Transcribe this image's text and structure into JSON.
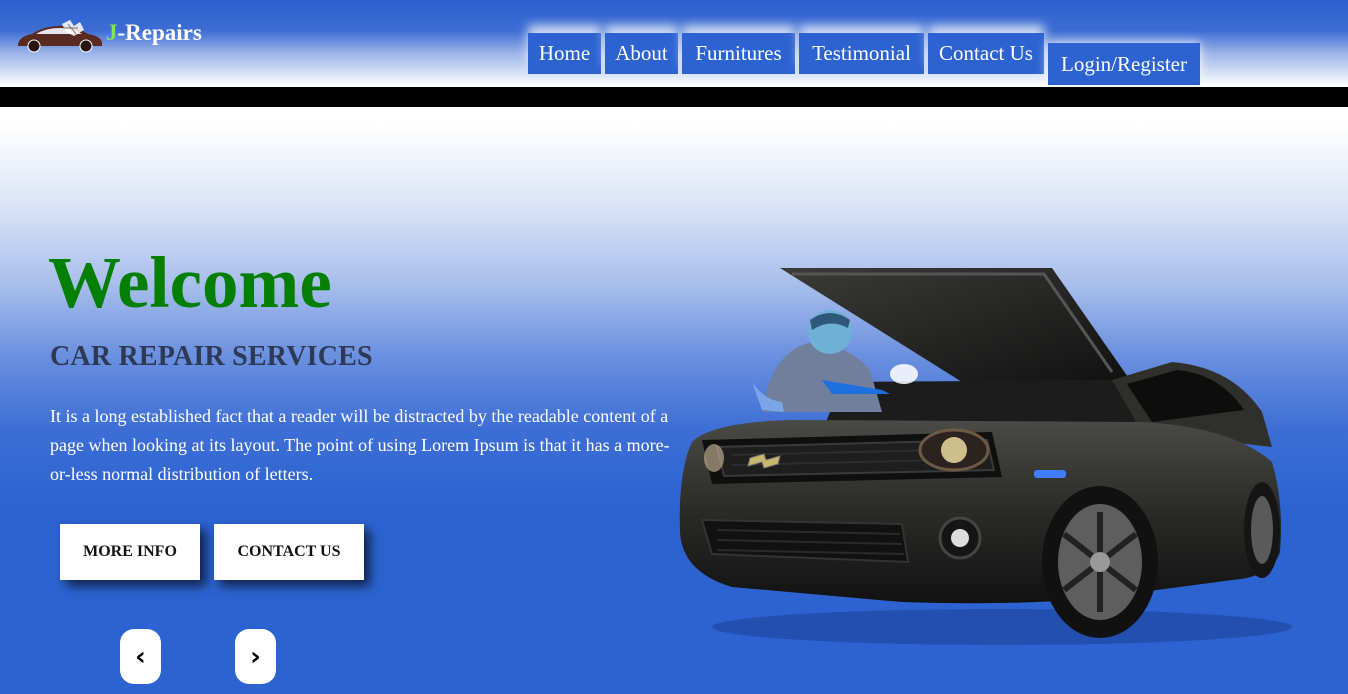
{
  "brand": {
    "prefix": "J",
    "rest": "-Repairs"
  },
  "nav": {
    "items": [
      {
        "label": "Home",
        "name": "nav-home",
        "width": 73
      },
      {
        "label": "About",
        "name": "nav-about",
        "width": 73
      },
      {
        "label": "Furnitures",
        "name": "nav-furnitures",
        "width": 113
      },
      {
        "label": "Testimonial",
        "name": "nav-testimonial",
        "width": 125
      },
      {
        "label": "Contact Us",
        "name": "nav-contact-us",
        "width": 116
      }
    ],
    "login_label": "Login/Register"
  },
  "hero": {
    "heading": "Welcome",
    "subtitle": "CAR REPAIR SERVICES",
    "description": "It is a long established fact that a reader will be distracted by the readable content of a page when looking at its layout. The point of using Lorem Ipsum is that it has a more-or-less normal distribution of letters.",
    "more_info_label": "MORE INFO",
    "contact_label": "CONTACT US",
    "prev_icon": "chevron-left-icon",
    "next_icon": "chevron-right-icon",
    "prev_glyph": "‹",
    "next_glyph": "›"
  },
  "colors": {
    "primary_blue": "#2c63d0",
    "welcome_green": "#058005",
    "brand_green": "#7ee84e",
    "subtitle_dark": "#2e3a55"
  }
}
